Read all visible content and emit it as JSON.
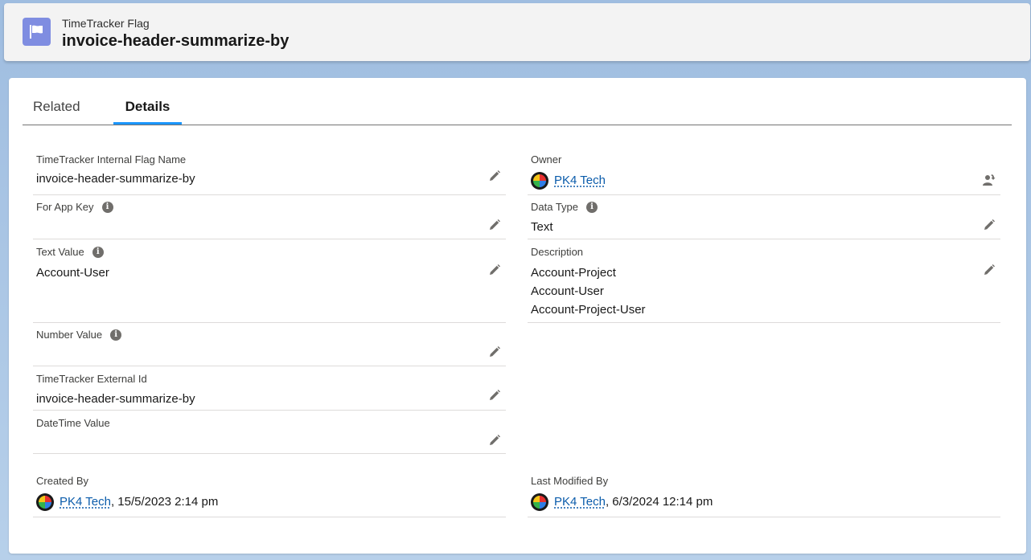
{
  "header": {
    "object_type": "TimeTracker Flag",
    "record_name": "invoice-header-summarize-by",
    "icon": "flag-icon"
  },
  "tabs": [
    {
      "label": "Related",
      "active": false
    },
    {
      "label": "Details",
      "active": true
    }
  ],
  "fields": {
    "internal_flag_name": {
      "label": "TimeTracker Internal Flag Name",
      "value": "invoice-header-summarize-by"
    },
    "for_app_key": {
      "label": "For App Key",
      "value": ""
    },
    "text_value": {
      "label": "Text Value",
      "value": "Account-User"
    },
    "number_value": {
      "label": "Number Value",
      "value": ""
    },
    "external_id": {
      "label": "TimeTracker External Id",
      "value": "invoice-header-summarize-by"
    },
    "datetime_value": {
      "label": "DateTime Value",
      "value": ""
    },
    "owner": {
      "label": "Owner",
      "value": "PK4 Tech"
    },
    "data_type": {
      "label": "Data Type",
      "value": "Text"
    },
    "description": {
      "label": "Description",
      "lines": [
        "Account-Project",
        "Account-User",
        "Account-Project-User"
      ]
    },
    "created_by": {
      "label": "Created By",
      "user": "PK4 Tech",
      "date": ", 15/5/2023 2:14 pm"
    },
    "last_modified_by": {
      "label": "Last Modified By",
      "user": "PK4 Tech",
      "date": ", 6/3/2024 12:14 pm"
    }
  },
  "info_glyph": "i",
  "colors": {
    "brand_blue": "#1b96ff",
    "link": "#0b5cab",
    "header_icon_bg": "#7f8de1"
  }
}
